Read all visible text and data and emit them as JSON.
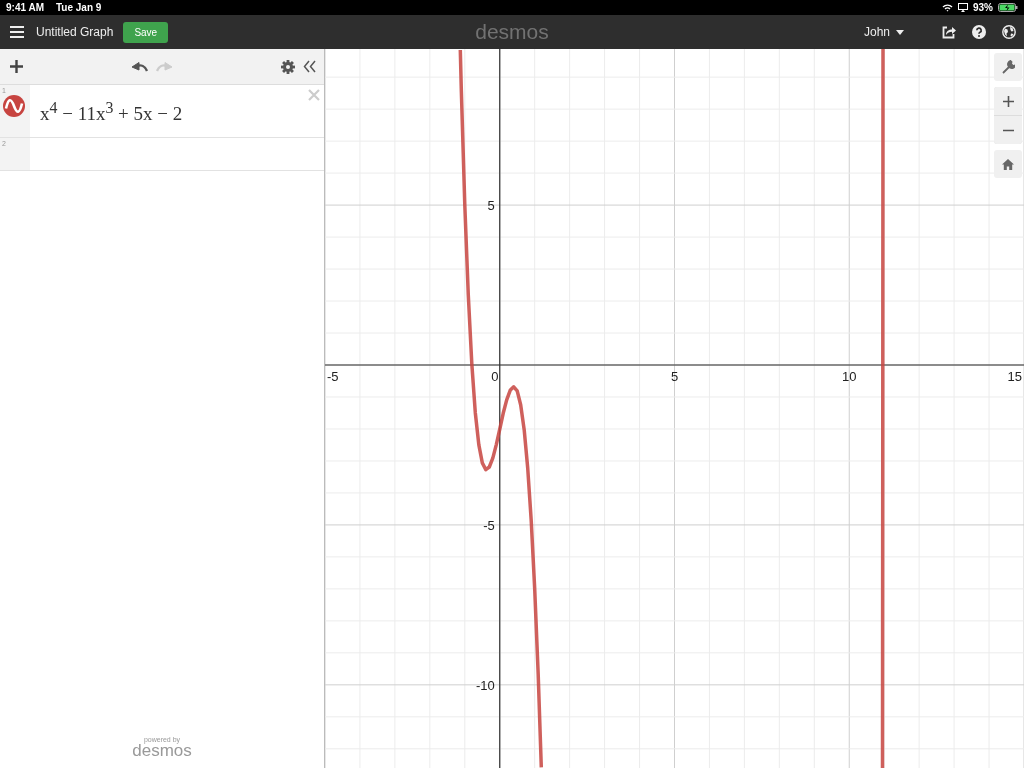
{
  "status_bar": {
    "time": "9:41 AM",
    "date": "Tue Jan 9",
    "battery": "93%",
    "charging": true
  },
  "header": {
    "title": "Untitled Graph",
    "save_button": "Save",
    "logo": "desmos",
    "user": "John"
  },
  "expression_toolbar": {
    "undo_disabled": false,
    "redo_disabled": true
  },
  "expressions": [
    {
      "index": "1",
      "kind": "function",
      "color": "#c74440",
      "latex": "x$^{4}$ − 11x$^{3}$ + 5x − 2"
    },
    {
      "index": "2",
      "kind": "empty"
    }
  ],
  "footer": {
    "powered_by": "powered by",
    "logo": "desmos"
  },
  "graph": {
    "chart_data": {
      "type": "line",
      "xlim": [
        -5,
        15
      ],
      "ylim": [
        -12.6,
        9.88
      ],
      "grid": true,
      "xticks": [
        -5,
        0,
        5,
        10,
        15
      ],
      "yticks": [
        -10,
        -5,
        5
      ],
      "x": [
        -1.13,
        -1.1,
        -1.0,
        -0.9,
        -0.8,
        -0.7,
        -0.6,
        -0.5,
        -0.4,
        -0.3,
        -0.2,
        -0.1,
        0,
        0.1,
        0.2,
        0.3,
        0.4,
        0.5,
        0.6,
        0.7,
        0.8,
        0.9,
        1.0,
        1.1,
        1.19,
        null,
        10.951,
        10.96,
        10.967
      ],
      "series": [
        {
          "color": "#c74440",
          "values": [
            9.85,
            8.61,
            5,
            2.18,
            0.04,
            -1.49,
            -2.49,
            -3.06,
            -3.27,
            -3.19,
            -2.91,
            -2.49,
            -2,
            -1.51,
            -1.09,
            -0.79,
            -0.68,
            -0.81,
            -1.25,
            -2.03,
            -3.22,
            -4.86,
            -7,
            -9.68,
            -12.58,
            null,
            -12.6,
            0.14,
            9.88
          ]
        }
      ]
    }
  }
}
